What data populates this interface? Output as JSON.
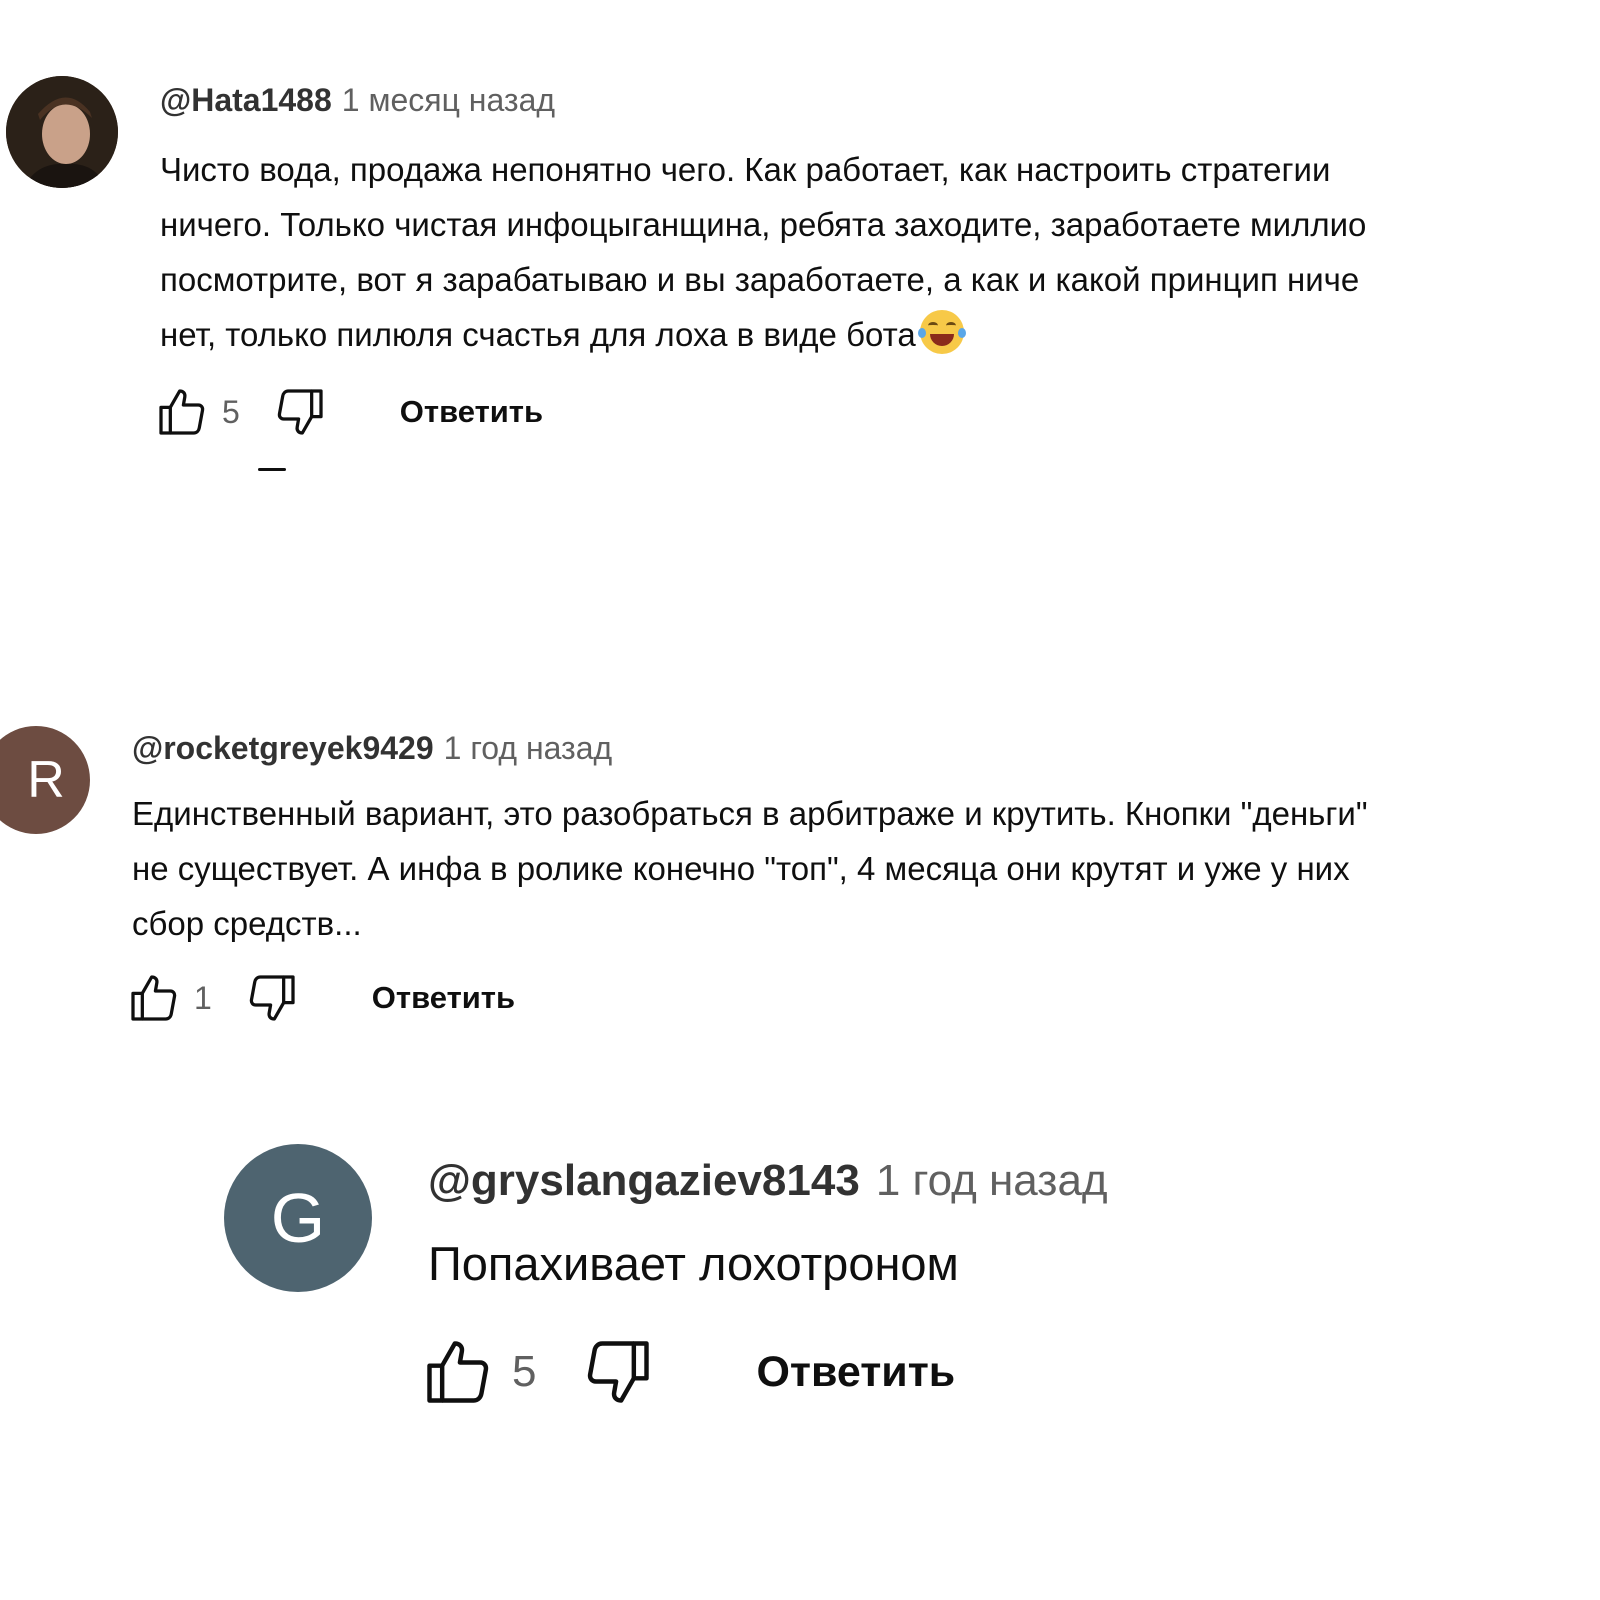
{
  "comments": [
    {
      "author": "@Hata1488",
      "time": "1 месяц назад",
      "avatar_letter": "",
      "avatar_color": "#3a2a1e",
      "lines": [
        "Чисто вода, продажа непонятно чего. Как работает, как настроить стратегии",
        "ничего. Только чистая инфоцыганщина, ребята заходите, заработаете миллио",
        "посмотрите, вот я зарабатываю и вы заработаете, а как и какой принцип ниче",
        "нет, только пилюля счастья для лоха в виде бота"
      ],
      "emoji": "face-with-tears-of-joy",
      "likes": "5",
      "reply_label": "Ответить"
    },
    {
      "author": "@rocketgreyek9429",
      "time": "1 год назад",
      "avatar_letter": "R",
      "avatar_color": "#6d4c41",
      "lines": [
        "Единственный вариант, это разобраться в арбитраже и крутить. Кнопки \"деньги\"",
        "не существует. А инфа в ролике конечно \"топ\", 4 месяца они крутят и уже у них",
        "сбор средств..."
      ],
      "likes": "1",
      "reply_label": "Ответить"
    },
    {
      "author": "@gryslangaziev8143",
      "time": "1 год назад",
      "avatar_letter": "G",
      "avatar_color": "#4e6470",
      "lines": [
        "Попахивает лохотроном"
      ],
      "likes": "5",
      "reply_label": "Ответить"
    }
  ],
  "icons": {
    "like": "thumbs-up-icon",
    "dislike": "thumbs-down-icon"
  }
}
